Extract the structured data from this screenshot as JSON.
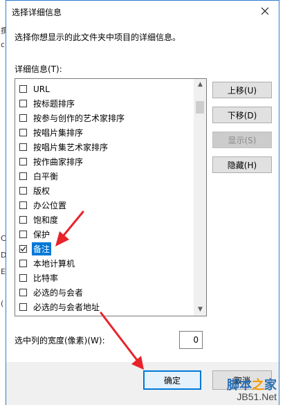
{
  "dialog": {
    "title": "选择详细信息",
    "description": "选择你想显示的此文件夹中项目的详细信息。",
    "list_label": "详细信息(T):",
    "items": [
      {
        "label": "URL",
        "checked": false,
        "selected": false
      },
      {
        "label": "按标题排序",
        "checked": false,
        "selected": false
      },
      {
        "label": "按参与创作的艺术家排序",
        "checked": false,
        "selected": false
      },
      {
        "label": "按唱片集排序",
        "checked": false,
        "selected": false
      },
      {
        "label": "按唱片集艺术家排序",
        "checked": false,
        "selected": false
      },
      {
        "label": "按作曲家排序",
        "checked": false,
        "selected": false
      },
      {
        "label": "白平衡",
        "checked": false,
        "selected": false
      },
      {
        "label": "版权",
        "checked": false,
        "selected": false
      },
      {
        "label": "办公位置",
        "checked": false,
        "selected": false
      },
      {
        "label": "饱和度",
        "checked": false,
        "selected": false
      },
      {
        "label": "保护",
        "checked": false,
        "selected": false
      },
      {
        "label": "备注",
        "checked": true,
        "selected": true
      },
      {
        "label": "本地计算机",
        "checked": false,
        "selected": false
      },
      {
        "label": "比特率",
        "checked": false,
        "selected": false
      },
      {
        "label": "必选的与会者",
        "checked": false,
        "selected": false
      },
      {
        "label": "必选的与会者地址",
        "checked": false,
        "selected": false
      }
    ],
    "buttons": {
      "move_up": "上移(U)",
      "move_down": "下移(D)",
      "show": "显示(S)",
      "hide": "隐藏(H)",
      "ok": "确定",
      "cancel": "取消"
    },
    "width_label": "选中列的宽度(像素)(W):",
    "width_value": "0"
  },
  "background_fragments": [
    "撰",
    "ck",
    "C",
    "D",
    "E",
    "("
  ],
  "icons": {
    "close": "close-icon",
    "scroll_up": "scroll-up-arrow-icon",
    "scroll_down": "scroll-down-arrow-icon",
    "checkmark": "checkmark-icon"
  },
  "watermark": {
    "line1": "脚本之家",
    "line2": "JB51.Net"
  },
  "colors": {
    "accent": "#0078d7",
    "annotation_arrow": "#e8232a",
    "dialog_border": "#2b7cd3"
  }
}
